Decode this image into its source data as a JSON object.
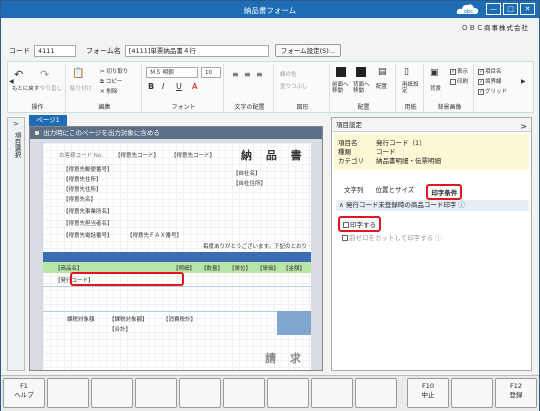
{
  "window": {
    "title": "納品書フォーム",
    "company": "ＯＢＣ商事株式会社",
    "minimize": "—",
    "maximize": "□",
    "close": "✕"
  },
  "code": {
    "label": "コード",
    "value": "4111"
  },
  "form_name": {
    "label": "フォーム名",
    "value": "[4111]単票納品書４行"
  },
  "form_settings_button": "フォーム設定(S)...",
  "ribbon": {
    "ops": {
      "undo": "もとに戻す",
      "redo": "やり直し",
      "label": "操作"
    },
    "edit": {
      "paste": "貼り付け",
      "cut": "切り取り",
      "copy": "コピー",
      "delete": "削除",
      "label": "編集"
    },
    "font": {
      "name": "ＭＳ 明朝",
      "size": "10",
      "bold": "B",
      "italic": "I",
      "underline": "U",
      "label": "フォント"
    },
    "align": {
      "label": "文字の配置"
    },
    "shape": {
      "line_color": "線の色",
      "fill_color": "塗りつぶし",
      "label": "図形"
    },
    "arrange": {
      "front": "前面へ移動",
      "back": "背面へ移動",
      "align": "配置",
      "label": "配置"
    },
    "paper": {
      "settings": "用紙設定",
      "label": "用紙"
    },
    "background": {
      "bg": "背景",
      "show": "表示",
      "print": "印刷",
      "label": "背景画像"
    },
    "display": {
      "item_name": "項目名",
      "border": "境界線",
      "grid": "グリッド"
    }
  },
  "side_tab": "項目選択",
  "page_tab": "ページ1",
  "canvas": {
    "header_check": "出力時にこのページを出力対象に含める",
    "customer_code": "お客様コード No.",
    "destination_code": "【得意先コード】",
    "sender_code": "【得意先コード】",
    "title": "納 品 書",
    "postal": "【得意先郵便番号】",
    "address1": "【得意先住所】",
    "address2": "【得意先住所】",
    "name1": "【得意先名】",
    "dept": "【得意先事業所名】",
    "person": "【得意先担当者名】",
    "phone": "【得意先電話番号】",
    "fax": "【得意先ＦＡＸ番号】",
    "own_name": "【自社名】",
    "own_address": "【自社住所】",
    "thanks": "毎度ありがとうございます。下記のとおり",
    "product_name": "【商品名】",
    "product_code": "【発行コード】",
    "detail": "【明細】",
    "qty": "【数量】",
    "unit": "【単位】",
    "price": "【単価】",
    "amount": "【金額】",
    "tax_target": "課税対象額",
    "tax_label": "【消費税計】",
    "tax_total": "【課税対象額】",
    "total_label": "【合計】",
    "receipt": "請 求"
  },
  "right_panel": {
    "title": "項目設定",
    "item_name_label": "項目名",
    "item_name": "発行コード（1）",
    "kind_label": "種類",
    "kind": "コード",
    "category_label": "カテゴリ",
    "category": "納品書明細・伝票明細",
    "tabs": [
      "文字列",
      "位置とサイズ",
      "印字条件"
    ],
    "section": "発行コード未登録時の商品コード印字",
    "opt_print": "印字する",
    "opt_zero": "前ゼロをカットして印字する"
  },
  "fkeys": [
    {
      "key": "F1",
      "label": "ヘルプ"
    },
    {
      "key": "",
      "label": ""
    },
    {
      "key": "",
      "label": ""
    },
    {
      "key": "",
      "label": ""
    },
    {
      "key": "",
      "label": ""
    },
    {
      "key": "",
      "label": ""
    },
    {
      "key": "",
      "label": ""
    },
    {
      "key": "",
      "label": ""
    },
    {
      "key": "",
      "label": ""
    },
    {
      "key": "F10",
      "label": "中止"
    },
    {
      "key": "",
      "label": ""
    },
    {
      "key": "F12",
      "label": "登録"
    }
  ]
}
